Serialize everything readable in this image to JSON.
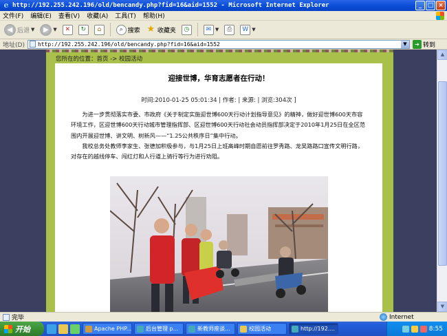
{
  "window": {
    "title": "http://192.255.242.196/old/bencandy.php?fid=16&aid=1552 - Microsoft Internet Explorer",
    "buttons": [
      "_",
      "□",
      "×"
    ]
  },
  "menu": [
    "文件(F)",
    "编辑(E)",
    "查看(V)",
    "收藏(A)",
    "工具(T)",
    "帮助(H)"
  ],
  "toolbar": {
    "back": "后退",
    "search": "搜索",
    "favorites": "收藏夹"
  },
  "address": {
    "label": "地址(D)",
    "url": "http://192.255.242.196/old/bencandy.php?fid=16&aid=1552",
    "go": "转到"
  },
  "page": {
    "breadcrumb": "您所在的位置：首页 -> 校园活动",
    "title": "迎接世博，华育志愿者在行动！",
    "meta": "时间:2010-01-25 05:01:34 | 作者:  | 来源:  | 浏览:304次 ]",
    "paragraphs": [
      "为进一步贯彻落实市委、市政府《关于制定实施迎世博600天行动计划指导意见》的精神，做好迎世博600天市容环境工作，区迎世博600天行动城市管理指挥部、区迎世博600天行动社会动员指挥部决定于2010年1月25日在全区范围内开展迎世博、讲文明、树新风——“1.25公共秩序日”集中行动。",
      "我校总务处教师李家生、张德加积极参与，与1月25日上班高峰时期自愿前往罗秀路、龙吴路路口宣传文明行路，对存在的越线停车、闯红灯和人行道上骑行等行为进行劝阻。"
    ]
  },
  "status": {
    "text": "完毕",
    "zone": "Internet"
  },
  "taskbar": {
    "start": "开始",
    "tasks": [
      "Apache PHP...",
      "后台管理 p...",
      "新教师座谈...",
      "校园活动",
      "http://192...."
    ],
    "clock": "8:55"
  },
  "colors": {
    "frame_green": "#a9c04a",
    "page_bg": "#3b4060",
    "titlebar_blue": "#0a4ed8"
  }
}
